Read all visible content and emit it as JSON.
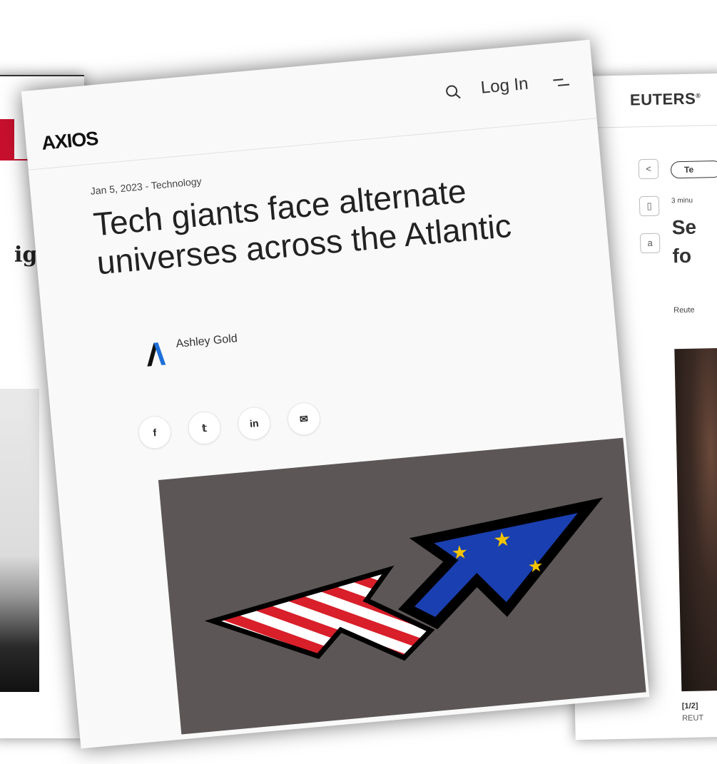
{
  "left_card": {
    "headline_fragment": "ig"
  },
  "axios": {
    "logo": "AXIOS",
    "header": {
      "login_label": "Log In",
      "search_icon": "search-icon",
      "menu_icon": "menu-icon"
    },
    "article": {
      "date": "Jan 5, 2023",
      "separator": " - ",
      "category": "Technology",
      "title": "Tech giants face alternate universes across the Atlantic",
      "author": "Ashley Gold"
    },
    "share": [
      {
        "icon": "facebook-icon",
        "label": "f"
      },
      {
        "icon": "twitter-icon",
        "label": "𝕥"
      },
      {
        "icon": "linkedin-icon",
        "label": "in"
      },
      {
        "icon": "email-icon",
        "label": "✉"
      }
    ],
    "hero_image": {
      "description_icons": [
        "us-flag-cursor",
        "eu-flag-cursor"
      ]
    },
    "colors": {
      "us_red": "#d81f2a",
      "eu_blue": "#1a3fb0",
      "eu_star": "#f5c400",
      "hero_bg": "#5c5656"
    }
  },
  "reuters": {
    "brand": "EUTERS",
    "brand_mark": "®",
    "tag": "Te",
    "read_time": "3 minu",
    "headline_fragment": "Se\nfo",
    "byline": "Reute",
    "caption": "[1/2]",
    "credit": "REUT",
    "tools": [
      "share-icon",
      "bookmark-icon",
      "text-size-icon"
    ],
    "text_size_label": "a"
  }
}
